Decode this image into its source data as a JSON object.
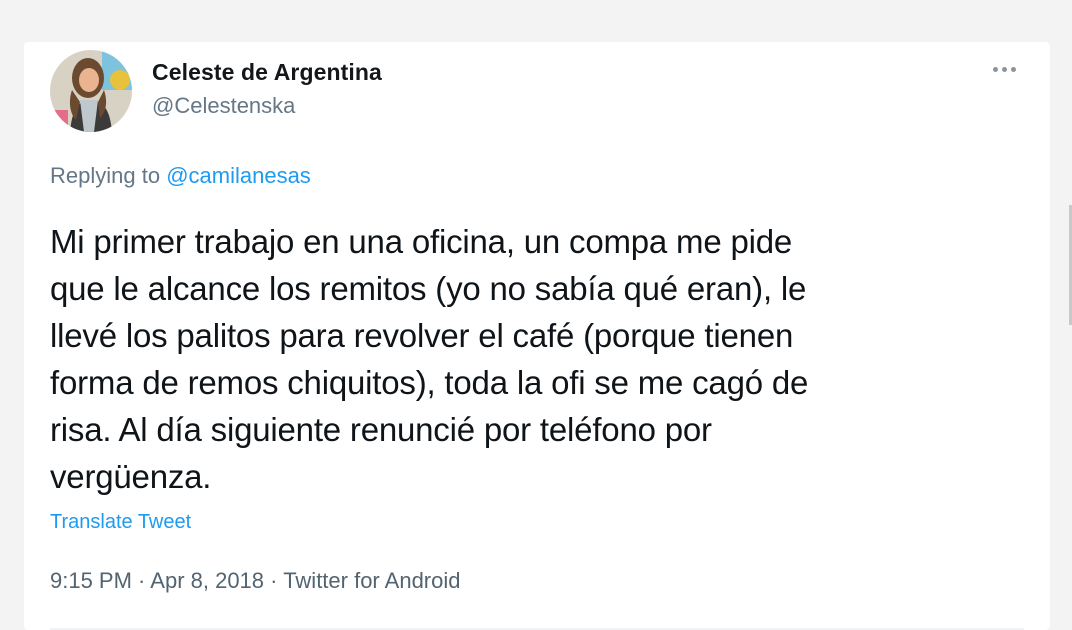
{
  "tweet": {
    "author_name": "Celeste de Argentina",
    "author_handle": "@Celestenska",
    "replying_prefix": "Replying to ",
    "replying_to": "@camilanesas",
    "text_lines": [
      "Mi primer trabajo en una oficina, un compa me pide",
      "que le alcance los remitos (yo no sabía qué eran), le",
      "llevé los palitos para revolver el café (porque tienen",
      "forma de remos chiquitos), toda la ofi se me cagó de",
      "risa. Al día siguiente renuncié por teléfono por",
      "vergüenza."
    ],
    "translate_label": "Translate Tweet",
    "time": "9:15 PM",
    "date": "Apr 8, 2018",
    "source": "Twitter for Android",
    "separator": " · "
  },
  "icons": {
    "more": "more-horizontal-icon",
    "avatar": "profile-photo"
  },
  "colors": {
    "link": "#1d9bf0",
    "secondary_text": "#657786",
    "primary_text": "#0f1419",
    "card_bg": "#ffffff",
    "page_bg": "#f3f3f4"
  }
}
